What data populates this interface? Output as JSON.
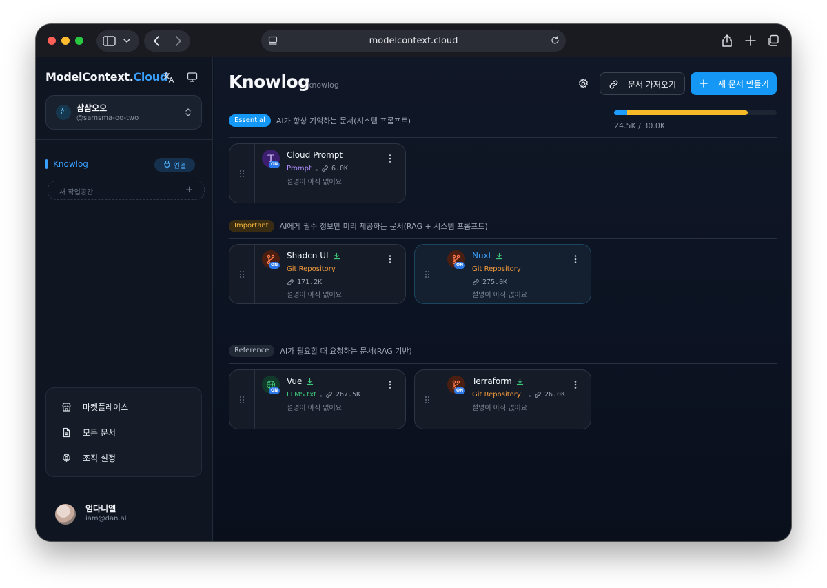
{
  "browser": {
    "url": "modelcontext.cloud"
  },
  "sidebar": {
    "brand_main": "ModelContext.",
    "brand_accent": "Cloud",
    "org": {
      "avatar_letter": "삼",
      "name": "삼삼오오",
      "handle": "@samsma-oo-two"
    },
    "workspaces": [
      {
        "label": "Knowlog",
        "active": true,
        "connect_label": "연결"
      }
    ],
    "new_workspace_placeholder": "새 작업공간",
    "new_workspace_plus": "+",
    "menu": [
      {
        "label": "마켓플레이스",
        "icon": "store-icon"
      },
      {
        "label": "모든 문서",
        "icon": "document-icon"
      },
      {
        "label": "조직 설정",
        "icon": "gear-icon"
      }
    ],
    "user": {
      "name": "엄다니엘",
      "email": "iam@dan.al"
    }
  },
  "main": {
    "title": "Knowlog",
    "subtitle": "knowlog",
    "import_button": "문서 가져오기",
    "new_button": "새 문서 만들기",
    "usage": {
      "text": "24.5K / 30.0K",
      "essential_fraction": 0.08,
      "important_fraction": 0.74,
      "colors": {
        "essential": "#1c9cff",
        "important": "#f7b928"
      }
    },
    "sections": [
      {
        "badge": "Essential",
        "description": "AI가 항상 기억하는 문서(시스템 프롬프트)",
        "cards": [
          {
            "name": "Cloud Prompt",
            "type": "Prompt",
            "size": "6.0K",
            "description": "설명이 아직 없어요",
            "icon": "text-t-icon",
            "status": "ON",
            "type_color": "#b08cff",
            "downloadable": false,
            "active": false
          }
        ]
      },
      {
        "badge": "Important",
        "description": "AI에게 필수 정보만 미리 제공하는 문서(RAG + 시스템 프롬프트)",
        "cards": [
          {
            "name": "Shadcn UI",
            "type": "Git Repository",
            "size": "171.2K",
            "description": "설명이 아직 없어요",
            "icon": "git-branch-icon",
            "status": "ON",
            "type_color": "#f39a3c",
            "downloadable": true,
            "active": false
          },
          {
            "name": "Nuxt",
            "type": "Git Repository",
            "size": "275.0K",
            "description": "설명이 아직 없어요",
            "icon": "git-branch-icon",
            "status": "ON",
            "type_color": "#f39a3c",
            "downloadable": true,
            "active": true
          }
        ]
      },
      {
        "badge": "Reference",
        "description": "AI가 필요할 때 요청하는 문서(RAG 기반)",
        "cards": [
          {
            "name": "Vue",
            "type": "LLMS.txt",
            "size": "267.5K",
            "description": "설명이 아직 없어요",
            "icon": "globe-icon",
            "status": "ON",
            "type_color": "#3fc77a",
            "downloadable": true,
            "active": false
          },
          {
            "name": "Terraform",
            "type": "Git Repository",
            "size": "26.0K",
            "description": "설명이 아직 없어요",
            "icon": "git-branch-icon",
            "status": "ON",
            "type_color": "#f39a3c",
            "downloadable": true,
            "active": false
          }
        ]
      }
    ]
  },
  "colors": {
    "accent": "#1597f5",
    "background": "#0b1220",
    "sidebar": "#0f1521"
  }
}
